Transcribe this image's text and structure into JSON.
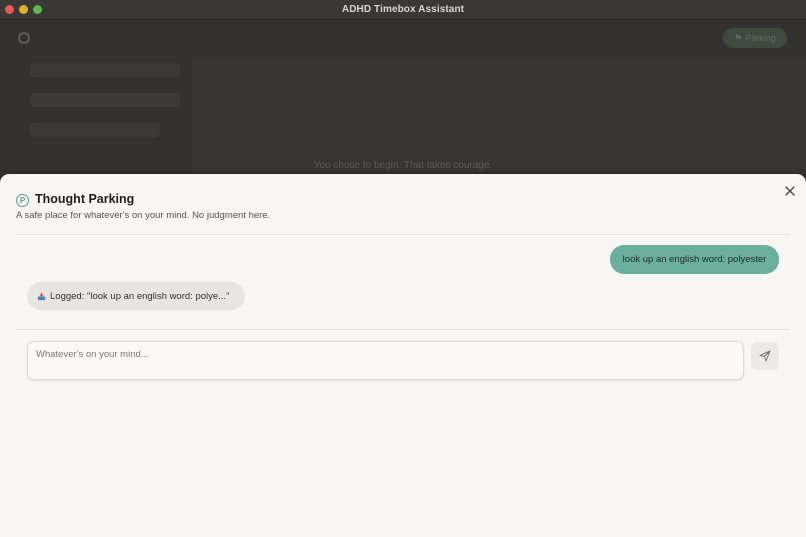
{
  "window": {
    "title": "ADHD Timebox Assistant"
  },
  "background": {
    "parking_label": "Parking",
    "encouragement": "You chose to begin. That takes courage."
  },
  "sheet": {
    "icon_letter": "P",
    "title": "Thought Parking",
    "subtitle": "A safe place for whatever's on your mind. No judgment here.",
    "messages": [
      {
        "role": "user",
        "text": "look up an english word: polyester"
      },
      {
        "role": "assistant",
        "text": "Logged: \"look up an english word: polye...\""
      }
    ],
    "input": {
      "placeholder": "Whatever's on your mind...",
      "value": ""
    }
  },
  "colors": {
    "accent": "#6bb09e",
    "user_bubble_text": "#1d2b27",
    "sheet_bg": "#f7f6f3"
  },
  "icons": {
    "close": "close-icon",
    "send": "send-icon",
    "logged": "inbox-tray-icon",
    "parking": "parking-icon",
    "settings": "gear-icon"
  }
}
